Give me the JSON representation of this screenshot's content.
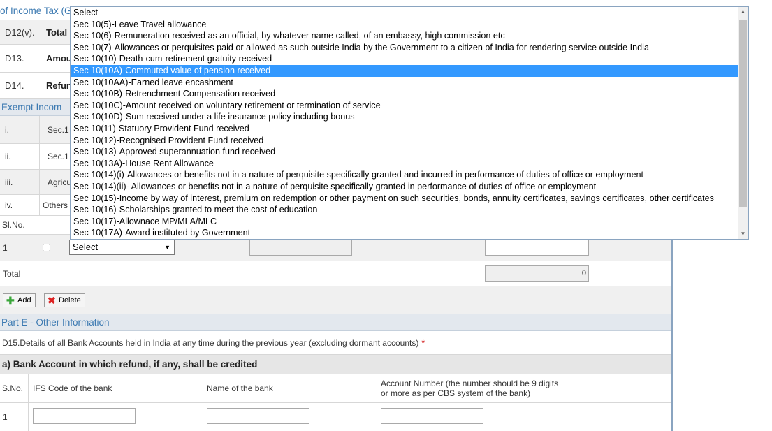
{
  "header": {
    "title_partial": "of Income Tax (G"
  },
  "rows": {
    "d12": {
      "code": "D12(v).",
      "label": "Total"
    },
    "d13": {
      "code": "D13.",
      "label": "Amou"
    },
    "d14": {
      "code": "D14.",
      "label": "Refun"
    }
  },
  "exempt": {
    "title_partial": "Exempt Incom",
    "items": [
      {
        "no": "i.",
        "label": "Sec.1"
      },
      {
        "no": "ii.",
        "label": "Sec.1"
      },
      {
        "no": "iii.",
        "label": "Agricu"
      },
      {
        "no": "iv.",
        "label": "Others"
      }
    ],
    "table": {
      "sl_header": "Sl.No.",
      "row_no": "1",
      "select_value": "Select",
      "total_label": "Total",
      "total_value": "0"
    },
    "add_label": "Add",
    "delete_label": "Delete"
  },
  "dropdown": {
    "options": [
      "Select",
      "Sec 10(5)-Leave Travel allowance",
      "Sec 10(6)-Remuneration received as an official, by whatever name called, of an embassy, high commission etc",
      "Sec 10(7)-Allowances or perquisites paid or allowed as such outside India by the Government to a citizen of India for rendering service outside India",
      "Sec 10(10)-Death-cum-retirement gratuity received",
      "Sec 10(10A)-Commuted value of pension received",
      "Sec 10(10AA)-Earned leave encashment",
      "Sec 10(10B)-Retrenchment Compensation received",
      "Sec 10(10C)-Amount received on voluntary retirement or termination of service",
      "Sec 10(10D)-Sum received under a life insurance policy including bonus",
      "Sec 10(11)-Statuory Provident Fund received",
      "Sec 10(12)-Recognised Provident Fund received",
      "Sec 10(13)-Approved superannuation fund received",
      "Sec 10(13A)-House Rent Allowance",
      "Sec 10(14)(i)-Allowances or benefits not in a nature of perquisite specifically granted and incurred in performance of duties of office or employment",
      "Sec 10(14)(ii)- Allowances or benefits not in a nature of perquisite specifically granted in performance of duties of office or employment",
      "Sec 10(15)-Income by way of interest, premium on redemption or other payment on such securities, bonds, annuity certificates, savings certificates, other certificates",
      "Sec 10(16)-Scholarships granted to meet the cost of education",
      "Sec 10(17)-Allownace MP/MLA/MLC",
      "Sec 10(17A)-Award instituted by Government"
    ],
    "highlighted_index": 5
  },
  "partE": {
    "title": "Part E - Other Information",
    "d15_text": "D15.Details of all Bank Accounts held in India at any time during the previous year (excluding dormant accounts)",
    "required_mark": "*",
    "sub_a": "a) Bank Account in which refund, if any, shall be credited",
    "col_sno": "S.No.",
    "col_ifs": "IFS Code of the bank",
    "col_name": "Name of the bank",
    "col_acc_line1": "Account Number (the number should be 9 digits",
    "col_acc_line2": "or more as per CBS system of the bank)",
    "row_no": "1"
  },
  "colors": {
    "accent": "#3b79b1",
    "highlight": "#3399ff",
    "required": "#cc0000"
  }
}
